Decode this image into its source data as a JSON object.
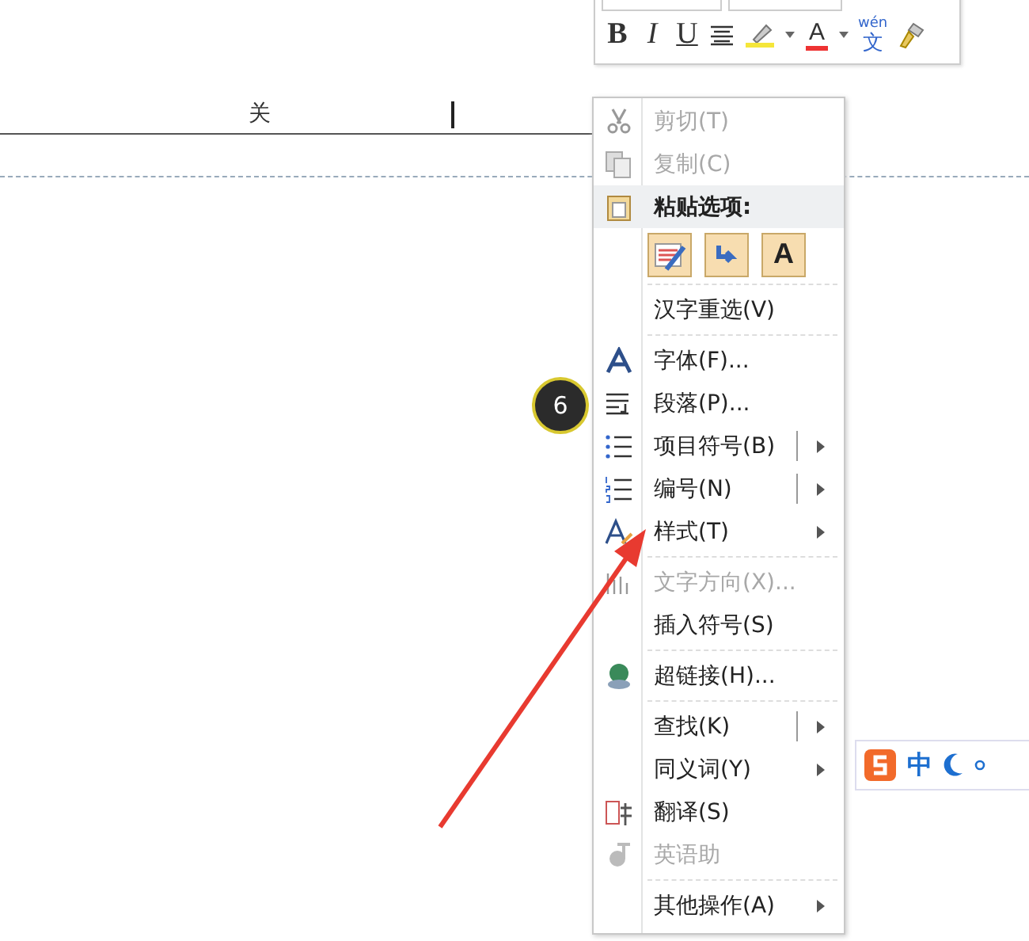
{
  "document": {
    "text": "关"
  },
  "mini_toolbar": {
    "buttons": [
      {
        "kind": "bold",
        "label": "B"
      },
      {
        "kind": "italic",
        "label": "I"
      },
      {
        "kind": "underline",
        "label": "U"
      },
      {
        "kind": "align"
      },
      {
        "kind": "highlight",
        "dropdown": true
      },
      {
        "kind": "fontcolor",
        "label": "A",
        "dropdown": true
      },
      {
        "kind": "phonetic",
        "label": "wén",
        "sub": "文"
      },
      {
        "kind": "painter"
      }
    ]
  },
  "context_menu": {
    "items": [
      {
        "kind": "item",
        "label": "剪切(T)",
        "disabled": true,
        "submenu": false,
        "split": false
      },
      {
        "kind": "item",
        "label": "复制(C)",
        "disabled": true,
        "submenu": false,
        "split": false
      },
      {
        "kind": "header",
        "label": "粘贴选项:"
      },
      {
        "kind": "paste_options",
        "options": [
          {
            "kind": "keep_formatting"
          },
          {
            "kind": "merge_formatting"
          },
          {
            "kind": "text_only",
            "label": "A"
          }
        ]
      },
      {
        "kind": "separator"
      },
      {
        "kind": "item",
        "label": "汉字重选(V)",
        "disabled": false,
        "submenu": false,
        "split": false
      },
      {
        "kind": "separator"
      },
      {
        "kind": "item",
        "label": "字体(F)...",
        "disabled": false,
        "submenu": false,
        "split": false
      },
      {
        "kind": "item",
        "label": "段落(P)...",
        "disabled": false,
        "submenu": false,
        "split": false
      },
      {
        "kind": "item",
        "label": "项目符号(B)",
        "disabled": false,
        "submenu": true,
        "split": true
      },
      {
        "kind": "item",
        "label": "编号(N)",
        "disabled": false,
        "submenu": true,
        "split": true
      },
      {
        "kind": "item",
        "label": "样式(T)",
        "disabled": false,
        "submenu": true,
        "split": false
      },
      {
        "kind": "separator"
      },
      {
        "kind": "item",
        "label": "文字方向(X)...",
        "disabled": true,
        "submenu": false,
        "split": false
      },
      {
        "kind": "item",
        "label": "插入符号(S)",
        "disabled": false,
        "submenu": false,
        "split": false
      },
      {
        "kind": "separator"
      },
      {
        "kind": "item",
        "label": "超链接(H)...",
        "disabled": false,
        "submenu": false,
        "split": false
      },
      {
        "kind": "separator"
      },
      {
        "kind": "item",
        "label": "查找(K)",
        "disabled": false,
        "submenu": true,
        "split": true
      },
      {
        "kind": "item",
        "label": "同义词(Y)",
        "disabled": false,
        "submenu": true,
        "split": false
      },
      {
        "kind": "item",
        "label": "翻译(S)",
        "disabled": false,
        "submenu": false,
        "split": false
      },
      {
        "kind": "item",
        "label": "英语助",
        "disabled": true,
        "submenu": false,
        "split": false
      },
      {
        "kind": "separator"
      },
      {
        "kind": "item",
        "label": "其他操作(A)",
        "disabled": false,
        "submenu": true,
        "split": false
      }
    ]
  },
  "step_badge": {
    "number": "6"
  },
  "ime_bar": {
    "mode": "中"
  }
}
